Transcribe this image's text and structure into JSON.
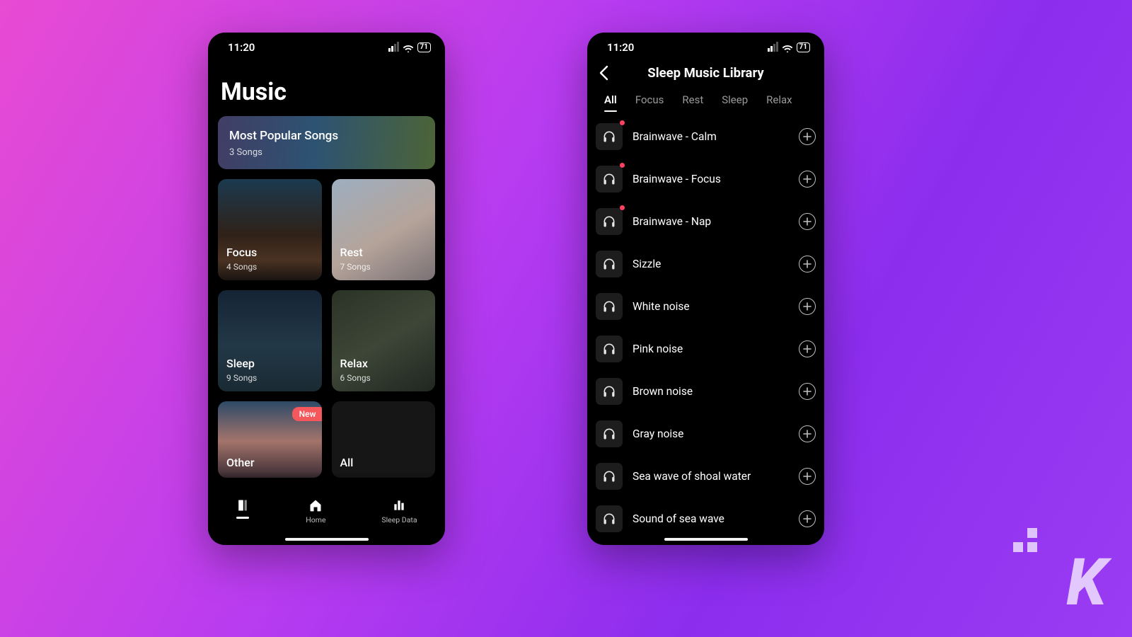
{
  "status": {
    "time": "11:20",
    "battery": "71"
  },
  "left": {
    "title": "Music",
    "popular": {
      "title": "Most Popular Songs",
      "sub": "3 Songs"
    },
    "categories": [
      {
        "title": "Focus",
        "sub": "4 Songs"
      },
      {
        "title": "Rest",
        "sub": "7 Songs"
      },
      {
        "title": "Sleep",
        "sub": "9 Songs"
      },
      {
        "title": "Relax",
        "sub": "6 Songs"
      },
      {
        "title": "Other",
        "sub": ""
      },
      {
        "title": "All",
        "sub": ""
      }
    ],
    "new_badge": "New",
    "tabbar": {
      "home": "Home",
      "sleepdata": "Sleep Data"
    }
  },
  "right": {
    "title": "Sleep Music Library",
    "tabs": [
      "All",
      "Focus",
      "Rest",
      "Sleep",
      "Relax"
    ],
    "active_tab": 0,
    "tracks": [
      {
        "name": "Brainwave - Calm",
        "dot": true
      },
      {
        "name": "Brainwave - Focus",
        "dot": true
      },
      {
        "name": "Brainwave - Nap",
        "dot": true
      },
      {
        "name": "Sizzle",
        "dot": false
      },
      {
        "name": "White noise",
        "dot": false
      },
      {
        "name": "Pink noise",
        "dot": false
      },
      {
        "name": "Brown noise",
        "dot": false
      },
      {
        "name": "Gray noise",
        "dot": false
      },
      {
        "name": "Sea wave of shoal water",
        "dot": false
      },
      {
        "name": "Sound of sea wave",
        "dot": false
      }
    ]
  }
}
